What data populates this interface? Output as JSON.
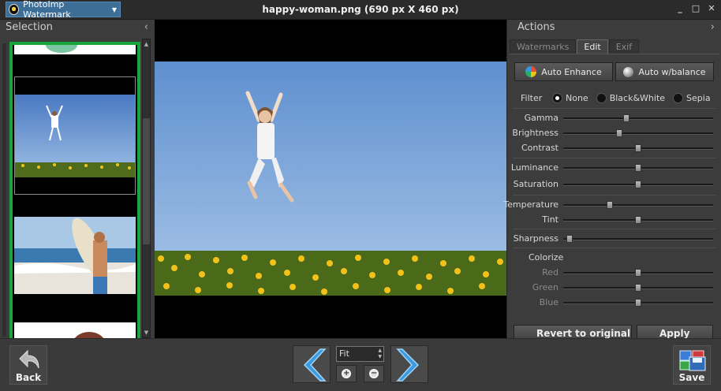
{
  "titlebar": {
    "app_menu_label": "PhotoImp Watermark",
    "window_title": "happy-woman.png (690 px X 460 px)",
    "minimize": "_",
    "maximize": "□",
    "close": "✕"
  },
  "left_panel": {
    "title": "Selection"
  },
  "right_panel": {
    "title": "Actions",
    "tabs": [
      {
        "label": "Watermarks"
      },
      {
        "label": "Edit"
      },
      {
        "label": "Exif"
      }
    ],
    "buttons": {
      "auto_enhance": "Auto Enhance",
      "auto_balance": "Auto w/balance",
      "revert": "Revert to original",
      "apply": "Apply"
    },
    "filter": {
      "label": "Filter",
      "options": [
        "None",
        "Black&White",
        "Sepia"
      ],
      "selected": "None"
    },
    "sliders": [
      {
        "label": "Gamma",
        "value": 0.42
      },
      {
        "label": "Brightness",
        "value": 0.37
      },
      {
        "label": "Contrast",
        "value": 0.5
      },
      {
        "label": "Luminance",
        "value": 0.5
      },
      {
        "label": "Saturation",
        "value": 0.5
      },
      {
        "label": "Temperature",
        "value": 0.3
      },
      {
        "label": "Tint",
        "value": 0.5
      },
      {
        "label": "Sharpness",
        "value": 0.02
      }
    ],
    "colorize": {
      "label": "Colorize",
      "channels": [
        {
          "label": "Red",
          "value": 0.5
        },
        {
          "label": "Green",
          "value": 0.5
        },
        {
          "label": "Blue",
          "value": 0.5
        }
      ]
    }
  },
  "bottombar": {
    "back_label": "Back",
    "zoom_value": "Fit",
    "save_label": "Save"
  },
  "colors": {
    "selection_border": "#19a53c",
    "nav_arrow": "#3a9be0",
    "app_menu_bg": "#3c6e97"
  }
}
